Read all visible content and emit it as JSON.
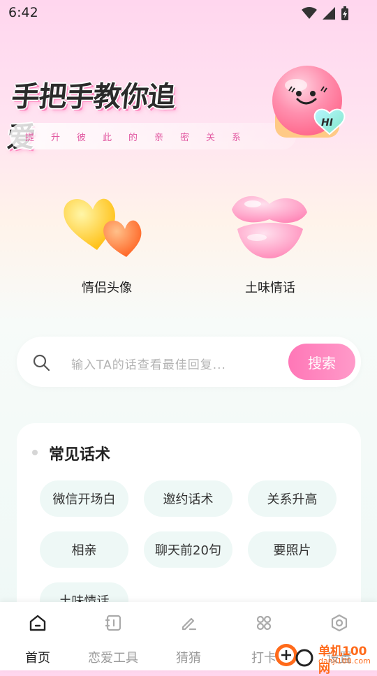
{
  "status_bar": {
    "time": "6:42"
  },
  "hero": {
    "title": "手把手教你追爱",
    "subtitle": "提升彼此的亲密关系",
    "mascot_text": "HI"
  },
  "features": [
    {
      "label": "情侣头像",
      "icon": "hearts-icon"
    },
    {
      "label": "土味情话",
      "icon": "lips-icon"
    }
  ],
  "search": {
    "placeholder": "输入TA的话查看最佳回复...",
    "button_label": "搜索"
  },
  "common_phrases": {
    "title": "常见话术",
    "items": [
      "微信开场白",
      "邀约话术",
      "关系升高",
      "相亲",
      "聊天前20句",
      "要照片",
      "土味情话"
    ]
  },
  "bottom_nav": {
    "items": [
      {
        "label": "首页",
        "icon": "home-icon",
        "active": true
      },
      {
        "label": "恋爱工具",
        "icon": "tools-icon",
        "active": false
      },
      {
        "label": "猜猜",
        "icon": "edit-icon",
        "active": false
      },
      {
        "label": "打卡",
        "icon": "grid-icon",
        "active": false
      },
      {
        "label": "设置",
        "icon": "settings-icon",
        "active": false
      }
    ]
  },
  "watermark": {
    "name": "单机100网",
    "url": "danji100.com"
  },
  "colors": {
    "accent": "#ff7ab8",
    "chip_bg": "#eef8f6"
  }
}
